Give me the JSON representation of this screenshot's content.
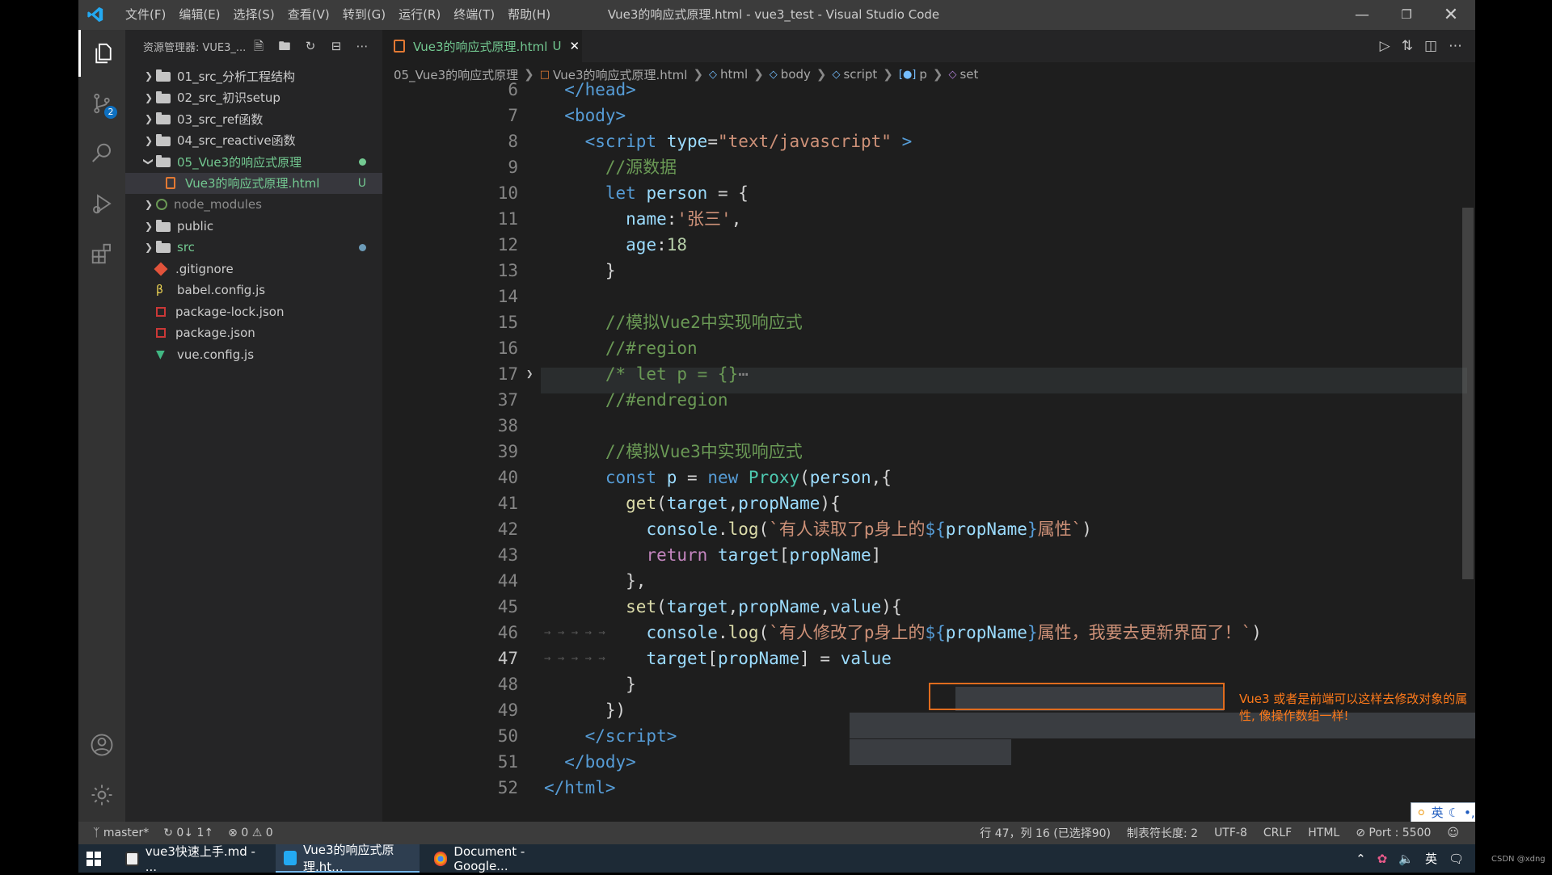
{
  "window": {
    "title": "Vue3的响应式原理.html - vue3_test - Visual Studio Code",
    "menus": [
      "文件(F)",
      "编辑(E)",
      "选择(S)",
      "查看(V)",
      "转到(G)",
      "运行(R)",
      "终端(T)",
      "帮助(H)"
    ]
  },
  "sidebar": {
    "title": "资源管理器: VUE3_...",
    "items": [
      {
        "label": "01_src_分析工程结构",
        "type": "folder"
      },
      {
        "label": "02_src_初识setup",
        "type": "folder"
      },
      {
        "label": "03_src_ref函数",
        "type": "folder"
      },
      {
        "label": "04_src_reactive函数",
        "type": "folder"
      },
      {
        "label": "05_Vue3的响应式原理",
        "type": "folder-open"
      },
      {
        "label": "Vue3的响应式原理.html",
        "type": "html",
        "status": "U"
      },
      {
        "label": "node_modules",
        "type": "folder"
      },
      {
        "label": "public",
        "type": "folder"
      },
      {
        "label": "src",
        "type": "folder"
      },
      {
        "label": ".gitignore",
        "type": "git"
      },
      {
        "label": "babel.config.js",
        "type": "babel"
      },
      {
        "label": "package-lock.json",
        "type": "json"
      },
      {
        "label": "package.json",
        "type": "json"
      },
      {
        "label": "vue.config.js",
        "type": "vue"
      }
    ]
  },
  "tab": {
    "label": "Vue3的响应式原理.html",
    "status": "U"
  },
  "breadcrumb": [
    "05_Vue3的响应式原理",
    "Vue3的响应式原理.html",
    "html",
    "body",
    "script",
    "p",
    "set"
  ],
  "code": {
    "line_numbers": [
      "6",
      "7",
      "8",
      "9",
      "10",
      "11",
      "12",
      "13",
      "14",
      "15",
      "16",
      "17",
      "37",
      "38",
      "39",
      "40",
      "41",
      "42",
      "43",
      "44",
      "45",
      "46",
      "47",
      "48",
      "49",
      "50",
      "51",
      "52"
    ],
    "annotation": "Vue3 或者是前端可以这样去修改对象的属性, 像操作数组一样!"
  },
  "status": {
    "branch": "master*",
    "sync": "0↓ 1↑",
    "problems": "⊗ 0 ⚠ 0",
    "position": "行 47，列 16 (已选择90)",
    "tab_size": "制表符长度: 2",
    "encoding": "UTF-8",
    "eol": "CRLF",
    "language": "HTML",
    "port": "⊘ Port : 5500"
  },
  "ime": {
    "lang": "英"
  },
  "taskbar": {
    "items": [
      "vue3快速上手.md - ...",
      "Vue3的响应式原理.ht...",
      "Document - Google..."
    ],
    "tray_lang": "英"
  },
  "watermark": "CSDN @xdng",
  "colors": {
    "accent": "#0e70c0",
    "modified": "#73c991",
    "annotation": "#ff7a1a"
  }
}
